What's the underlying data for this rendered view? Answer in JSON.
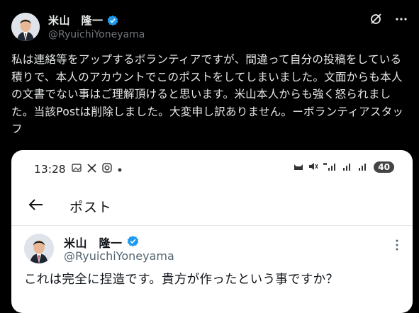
{
  "author": {
    "display_name": "米山　隆一",
    "handle": "@RyuichiYoneyama"
  },
  "header_icons": [
    "grok-icon",
    "more-icon"
  ],
  "tweet": {
    "text": "私は連絡等をアップするボランティアですが、間違って自分の投稿をしている積りで、本人のアカウントでこのポストをしてしまいました。文面からも本人の文書でない事はご理解頂けると思います。米山本人からも強く怒られました。当該Postは削除しました。大変申し訳ありません。ーボランティアスタッフ"
  },
  "screenshot": {
    "status_time": "13:28",
    "battery": "40",
    "nav_title": "ポスト",
    "author_name": "米山　隆一",
    "author_handle": "@RyuichiYoneyama",
    "post_text": "これは完全に捏造です。貴方が作ったという事ですか？"
  },
  "colors": {
    "background": "#000000",
    "text": "#e7e9ea",
    "handle": "#71767b",
    "verified": "#1d9bf0"
  }
}
